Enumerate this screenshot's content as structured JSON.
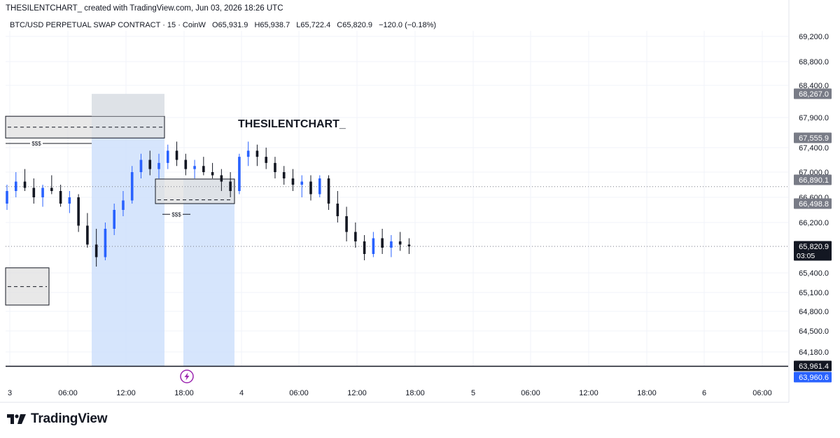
{
  "header": {
    "credit": "THESILENTCHART_  created with TradingView.com, Jun 03, 2026 18:26 UTC"
  },
  "symbol": {
    "name": "BTC/USD PERPETUAL SWAP CONTRACT · 15 · CoinW",
    "open": "O65,931.9",
    "high": "H65,938.7",
    "low": "L65,722.4",
    "close": "C65,820.9",
    "change": "−120.0 (−0.18%)"
  },
  "watermark": "THESILENTCHART_",
  "footer": {
    "brand": "TradingView"
  },
  "colors": {
    "up": "#2962ff",
    "down": "#131722",
    "zone_gray": "#e0e0e0",
    "zone_blue": "#cfe0fc",
    "accent": "#2962ff"
  },
  "chart_data": {
    "type": "candlestick",
    "interval": "15",
    "y_axis_labels": [
      "69,200.0",
      "68,800.0",
      "68,400.0",
      "67,900.0",
      "67,400.0",
      "67,000.0",
      "66,600.0",
      "66,200.0",
      "65,400.0",
      "65,100.0",
      "64,800.0",
      "64,500.0",
      "64,180.0"
    ],
    "y_ticks": [
      69200,
      68800,
      68400,
      67900,
      67400,
      67000,
      66600,
      66200,
      65400,
      65100,
      64800,
      64500,
      64180
    ],
    "ylim": [
      63850,
      69400
    ],
    "x_tick_labels": [
      "3",
      "06:00",
      "12:00",
      "18:00",
      "4",
      "06:00",
      "12:00",
      "18:00",
      "5",
      "06:00",
      "12:00",
      "18:00",
      "6",
      "06:00"
    ],
    "price_tags": [
      {
        "label": "68,267.0",
        "value": 68267.0,
        "style": "gray"
      },
      {
        "label": "67,555.9",
        "value": 67555.9,
        "style": "gray"
      },
      {
        "label": "66,890.1",
        "value": 66890.1,
        "style": "gray"
      },
      {
        "label": "66,498.8",
        "value": 66498.8,
        "style": "gray"
      },
      {
        "label": "65,820.9",
        "value": 65820.9,
        "style": "dark",
        "sub": "03:05"
      },
      {
        "label": "63,961.4",
        "value": 63961.4,
        "style": "dark"
      },
      {
        "label": "63,960.6",
        "value": 63960.6,
        "style": "blue"
      }
    ],
    "horizontal_lines": [
      {
        "value": 65820.9,
        "style": "dotted"
      },
      {
        "value": 66770,
        "style": "dotted"
      },
      {
        "value": 63961.4,
        "style": "solid"
      }
    ],
    "sss_labels": [
      {
        "label": "$$$",
        "level": 67470
      },
      {
        "label": "$$$",
        "level": 66330
      }
    ],
    "ohlc": [
      [
        66500,
        66800,
        66400,
        66700
      ],
      [
        66700,
        67000,
        66600,
        66850
      ],
      [
        66850,
        67050,
        66700,
        66750
      ],
      [
        66750,
        66900,
        66500,
        66600
      ],
      [
        66600,
        66800,
        66450,
        66750
      ],
      [
        66750,
        66950,
        66650,
        66700
      ],
      [
        66700,
        66800,
        66450,
        66500
      ],
      [
        66500,
        66700,
        66350,
        66600
      ],
      [
        66600,
        66650,
        66050,
        66150
      ],
      [
        66150,
        66350,
        65800,
        65850
      ],
      [
        65850,
        66100,
        65500,
        65650
      ],
      [
        65650,
        66200,
        65600,
        66100
      ],
      [
        66100,
        66500,
        66000,
        66400
      ],
      [
        66400,
        66700,
        66300,
        66550
      ],
      [
        66550,
        67100,
        66500,
        67000
      ],
      [
        67000,
        67300,
        66900,
        67200
      ],
      [
        67200,
        67350,
        66950,
        67050
      ],
      [
        67050,
        67300,
        66900,
        67150
      ],
      [
        67150,
        67450,
        67050,
        67350
      ],
      [
        67350,
        67500,
        67100,
        67200
      ],
      [
        67200,
        67300,
        66950,
        67050
      ],
      [
        67050,
        67200,
        66900,
        67100
      ],
      [
        67100,
        67250,
        66950,
        67000
      ],
      [
        67000,
        67150,
        66900,
        66950
      ],
      [
        66950,
        67050,
        66700,
        66850
      ],
      [
        66850,
        67000,
        66600,
        66700
      ],
      [
        66700,
        67300,
        66650,
        67250
      ],
      [
        67250,
        67500,
        67100,
        67350
      ],
      [
        67350,
        67450,
        67100,
        67250
      ],
      [
        67250,
        67400,
        67050,
        67150
      ],
      [
        67150,
        67250,
        66900,
        67000
      ],
      [
        67000,
        67100,
        66800,
        66900
      ],
      [
        66900,
        67050,
        66700,
        66800
      ],
      [
        66800,
        66950,
        66600,
        66850
      ],
      [
        66850,
        66950,
        66550,
        66650
      ],
      [
        66650,
        66950,
        66600,
        66900
      ],
      [
        66900,
        66950,
        66400,
        66500
      ],
      [
        66500,
        66700,
        66200,
        66300
      ],
      [
        66300,
        66450,
        65900,
        66050
      ],
      [
        66050,
        66200,
        65800,
        65900
      ],
      [
        65900,
        66000,
        65600,
        65700
      ],
      [
        65700,
        66050,
        65650,
        65950
      ],
      [
        65950,
        66100,
        65700,
        65800
      ],
      [
        65800,
        66000,
        65650,
        65900
      ],
      [
        65900,
        66050,
        65750,
        65850
      ],
      [
        65850,
        65950,
        65700,
        65820
      ]
    ],
    "zones": [
      {
        "type": "gray-box",
        "t0": 0,
        "t1": 27.5,
        "top": 67920,
        "bottom": 67560,
        "midline": 67740
      },
      {
        "type": "gray-box",
        "t0": 0,
        "t1": 7.5,
        "top": 65480,
        "bottom": 64900,
        "midline": 65190
      },
      {
        "type": "gray-box",
        "t0": 14.5,
        "t1": 27.5,
        "top": 68267,
        "bottom": 67920
      },
      {
        "type": "gray-box",
        "t0": 26.5,
        "t1": 40.5,
        "top": 66890,
        "bottom": 66500,
        "midline": 66560
      },
      {
        "type": "blue-range",
        "t0": 14.5,
        "t1": 27.5,
        "top": 68267,
        "bottom": 63961.4
      },
      {
        "type": "blue-range",
        "t0": 30.5,
        "t1": 40.5,
        "top": 66890,
        "bottom": 63961.4
      }
    ]
  }
}
